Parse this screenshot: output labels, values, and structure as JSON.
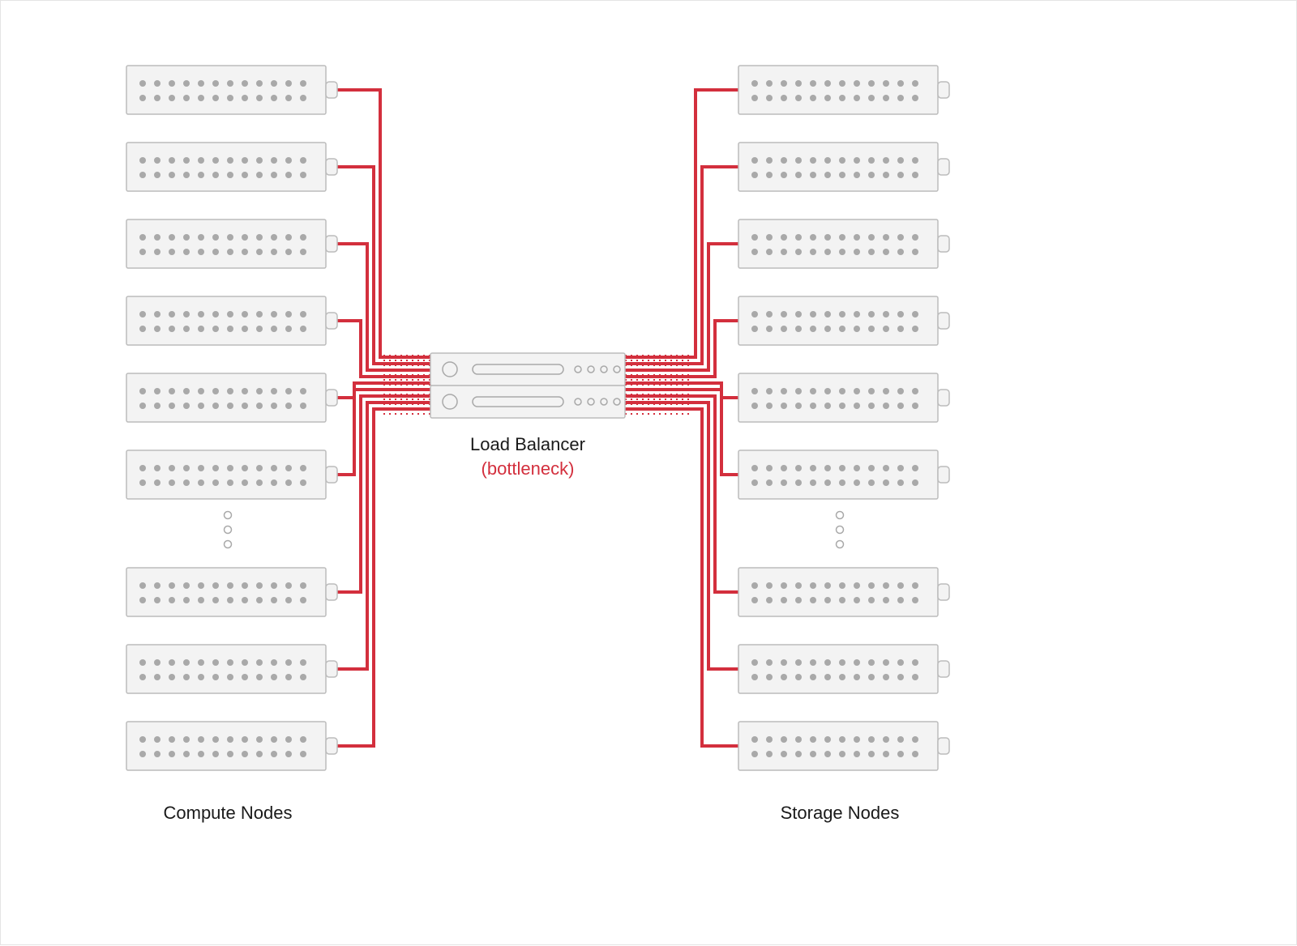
{
  "center": {
    "title": "Load Balancer",
    "subtitle": "(bottleneck)"
  },
  "left": {
    "label": "Compute Nodes"
  },
  "right": {
    "label": "Storage Nodes"
  },
  "colors": {
    "wire": "#d32f3d",
    "box_stroke": "#bcbcbc",
    "box_fill": "#f3f3f3",
    "dot": "#a9a9a9"
  },
  "layout": {
    "node_count_per_side": 9,
    "servers_in_center": 2
  }
}
